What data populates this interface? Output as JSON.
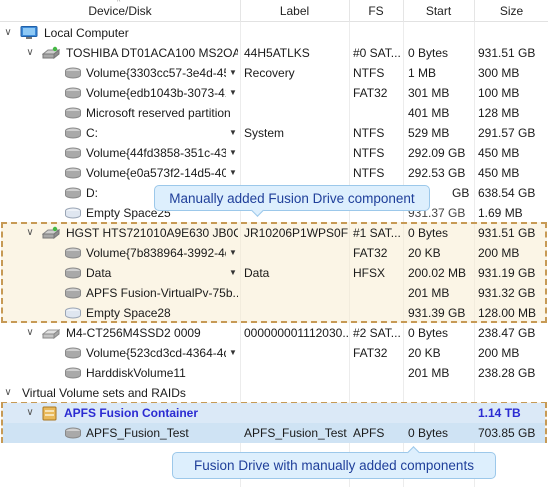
{
  "columns": {
    "device": "Device/Disk",
    "label": "Label",
    "fs": "FS",
    "start": "Start",
    "size": "Size"
  },
  "rows": [
    {
      "name": "Local Computer",
      "label": "",
      "fs": "",
      "start": "",
      "size": "",
      "icon": "computer-icon"
    },
    {
      "name": "TOSHIBA DT01ACA100 MS2OA...",
      "label": "44H5ATLKS",
      "fs": "#0 SAT...",
      "start": "0 Bytes",
      "size": "931.51 GB",
      "icon": "hard-drive-icon"
    },
    {
      "name": "Volume{3303cc57-3e4d-45...",
      "label": "Recovery",
      "fs": "NTFS",
      "start": "1 MB",
      "size": "300 MB",
      "icon": "volume-icon"
    },
    {
      "name": "Volume{edb1043b-3073-41...",
      "label": "",
      "fs": "FAT32",
      "start": "301 MB",
      "size": "100 MB",
      "icon": "volume-icon"
    },
    {
      "name": "Microsoft reserved partition",
      "label": "",
      "fs": "",
      "start": "401 MB",
      "size": "128 MB",
      "icon": "volume-icon"
    },
    {
      "name": "C:",
      "label": "System",
      "fs": "NTFS",
      "start": "529 MB",
      "size": "291.57 GB",
      "icon": "volume-icon"
    },
    {
      "name": "Volume{44fd3858-351c-43f...",
      "label": "",
      "fs": "NTFS",
      "start": "292.09 GB",
      "size": "450 MB",
      "icon": "volume-icon"
    },
    {
      "name": "Volume{e0a573f2-14d5-40...",
      "label": "",
      "fs": "NTFS",
      "start": "292.53 GB",
      "size": "450 MB",
      "icon": "volume-icon"
    },
    {
      "name": "D:",
      "label": "",
      "fs": "",
      "start": "GB",
      "size": "638.54 GB",
      "icon": "volume-icon"
    },
    {
      "name": "Empty Space25",
      "label": "",
      "fs": "",
      "start": "931.37 GB",
      "size": "1.69 MB",
      "icon": "empty-space-icon"
    },
    {
      "name": "HGST HTS721010A9E630 JB0O...",
      "label": "JR10206P1WPS0F",
      "fs": "#1 SAT...",
      "start": "0 Bytes",
      "size": "931.51 GB",
      "icon": "hard-drive-icon"
    },
    {
      "name": "Volume{7b838964-3992-4d...",
      "label": "",
      "fs": "FAT32",
      "start": "20 KB",
      "size": "200 MB",
      "icon": "volume-icon"
    },
    {
      "name": "Data",
      "label": "Data",
      "fs": "HFSX",
      "start": "200.02 MB",
      "size": "931.19 GB",
      "icon": "volume-icon"
    },
    {
      "name": "APFS Fusion-VirtualPv-75b...",
      "label": "",
      "fs": "",
      "start": "201 MB",
      "size": "931.32 GB",
      "icon": "volume-icon"
    },
    {
      "name": "Empty Space28",
      "label": "",
      "fs": "",
      "start": "931.39 GB",
      "size": "128.00 MB",
      "icon": "empty-space-icon"
    },
    {
      "name": "M4-CT256M4SSD2 0009",
      "label": "000000001112030...",
      "fs": "#2 SAT...",
      "start": "0 Bytes",
      "size": "238.47 GB",
      "icon": "ssd-icon"
    },
    {
      "name": "Volume{523cd3cd-4364-4d...",
      "label": "",
      "fs": "FAT32",
      "start": "20 KB",
      "size": "200 MB",
      "icon": "volume-icon"
    },
    {
      "name": "HarddiskVolume11",
      "label": "",
      "fs": "",
      "start": "201 MB",
      "size": "238.28 GB",
      "icon": "volume-icon"
    },
    {
      "name": "Virtual Volume sets and RAIDs",
      "label": "",
      "fs": "",
      "start": "",
      "size": "",
      "icon": ""
    },
    {
      "name": "APFS Fusion Container",
      "label": "",
      "fs": "",
      "start": "",
      "size": "1.14 TB",
      "icon": "container-icon"
    },
    {
      "name": "APFS_Fusion_Test",
      "label": "APFS_Fusion_Test",
      "fs": "APFS",
      "start": "0 Bytes",
      "size": "703.85 GB",
      "icon": "volume-icon"
    }
  ],
  "callouts": {
    "manual_component": "Manually added Fusion Drive component",
    "fusion_drive": "Fusion Drive with manually added components"
  },
  "colors": {
    "accent_blue_text": "#2b2bd2",
    "dashed_border": "#c79a55",
    "callout_bg": "#ddeffd",
    "callout_text": "#1f3f9a",
    "selection": "#cfe3f4"
  }
}
